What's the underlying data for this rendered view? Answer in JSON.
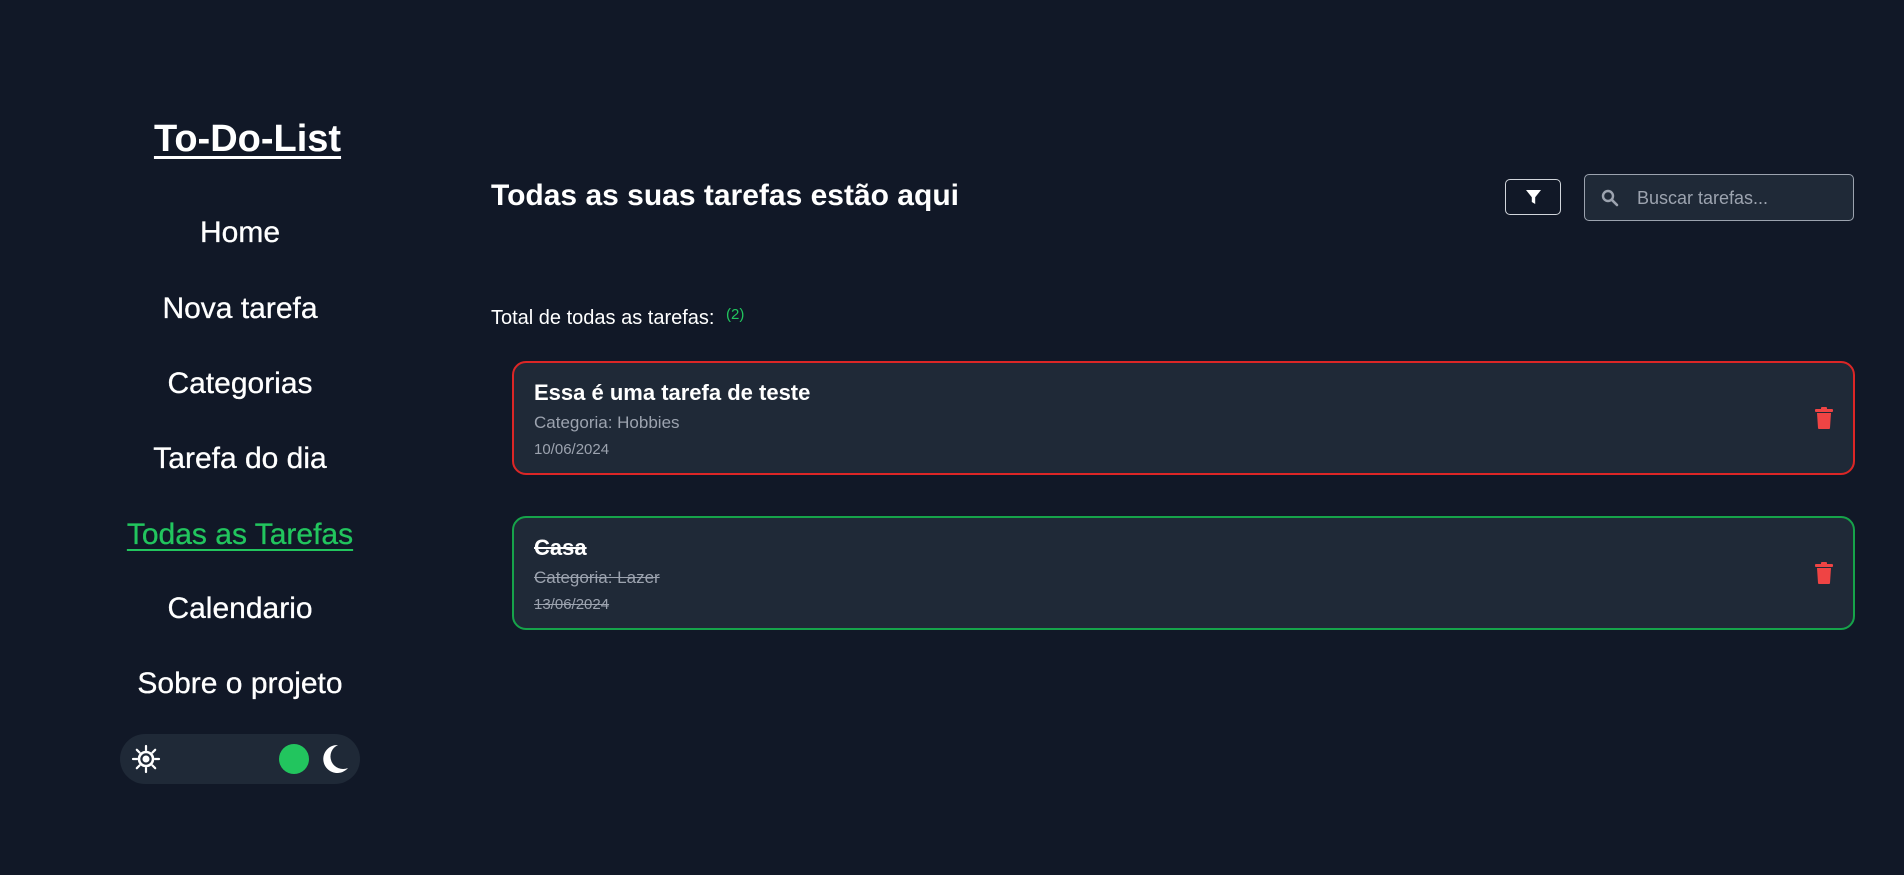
{
  "sidebar": {
    "logo": "To-Do-List",
    "items": [
      {
        "label": "Home",
        "active": false
      },
      {
        "label": "Nova tarefa",
        "active": false
      },
      {
        "label": "Categorias",
        "active": false
      },
      {
        "label": "Tarefa do dia",
        "active": false
      },
      {
        "label": "Todas as Tarefas",
        "active": true
      },
      {
        "label": "Calendario",
        "active": false
      },
      {
        "label": "Sobre o projeto",
        "active": false
      }
    ],
    "theme_toggle": {
      "left_icon": "sun-icon",
      "right_icon": "moon-icon",
      "mode": "dark"
    }
  },
  "header": {
    "title": "Todas as suas tarefas estão aqui",
    "filter_icon": "filter-icon",
    "search": {
      "placeholder": "Buscar tarefas...",
      "value": "",
      "icon": "search-icon"
    }
  },
  "summary": {
    "label": "Total de todas as tarefas:",
    "count": "(2)"
  },
  "tasks": [
    {
      "title": "Essa é uma tarefa de teste",
      "category": "Categoria: Hobbies",
      "date": "10/06/2024",
      "completed": false,
      "border_color": "#dc2626"
    },
    {
      "title": "Casa",
      "category": "Categoria: Lazer",
      "date": "13/06/2024",
      "completed": true,
      "border_color": "#16a34a"
    }
  ],
  "colors": {
    "background": "#111827",
    "card": "#1f2937",
    "accent": "#22c55e",
    "danger": "#ef4444"
  }
}
